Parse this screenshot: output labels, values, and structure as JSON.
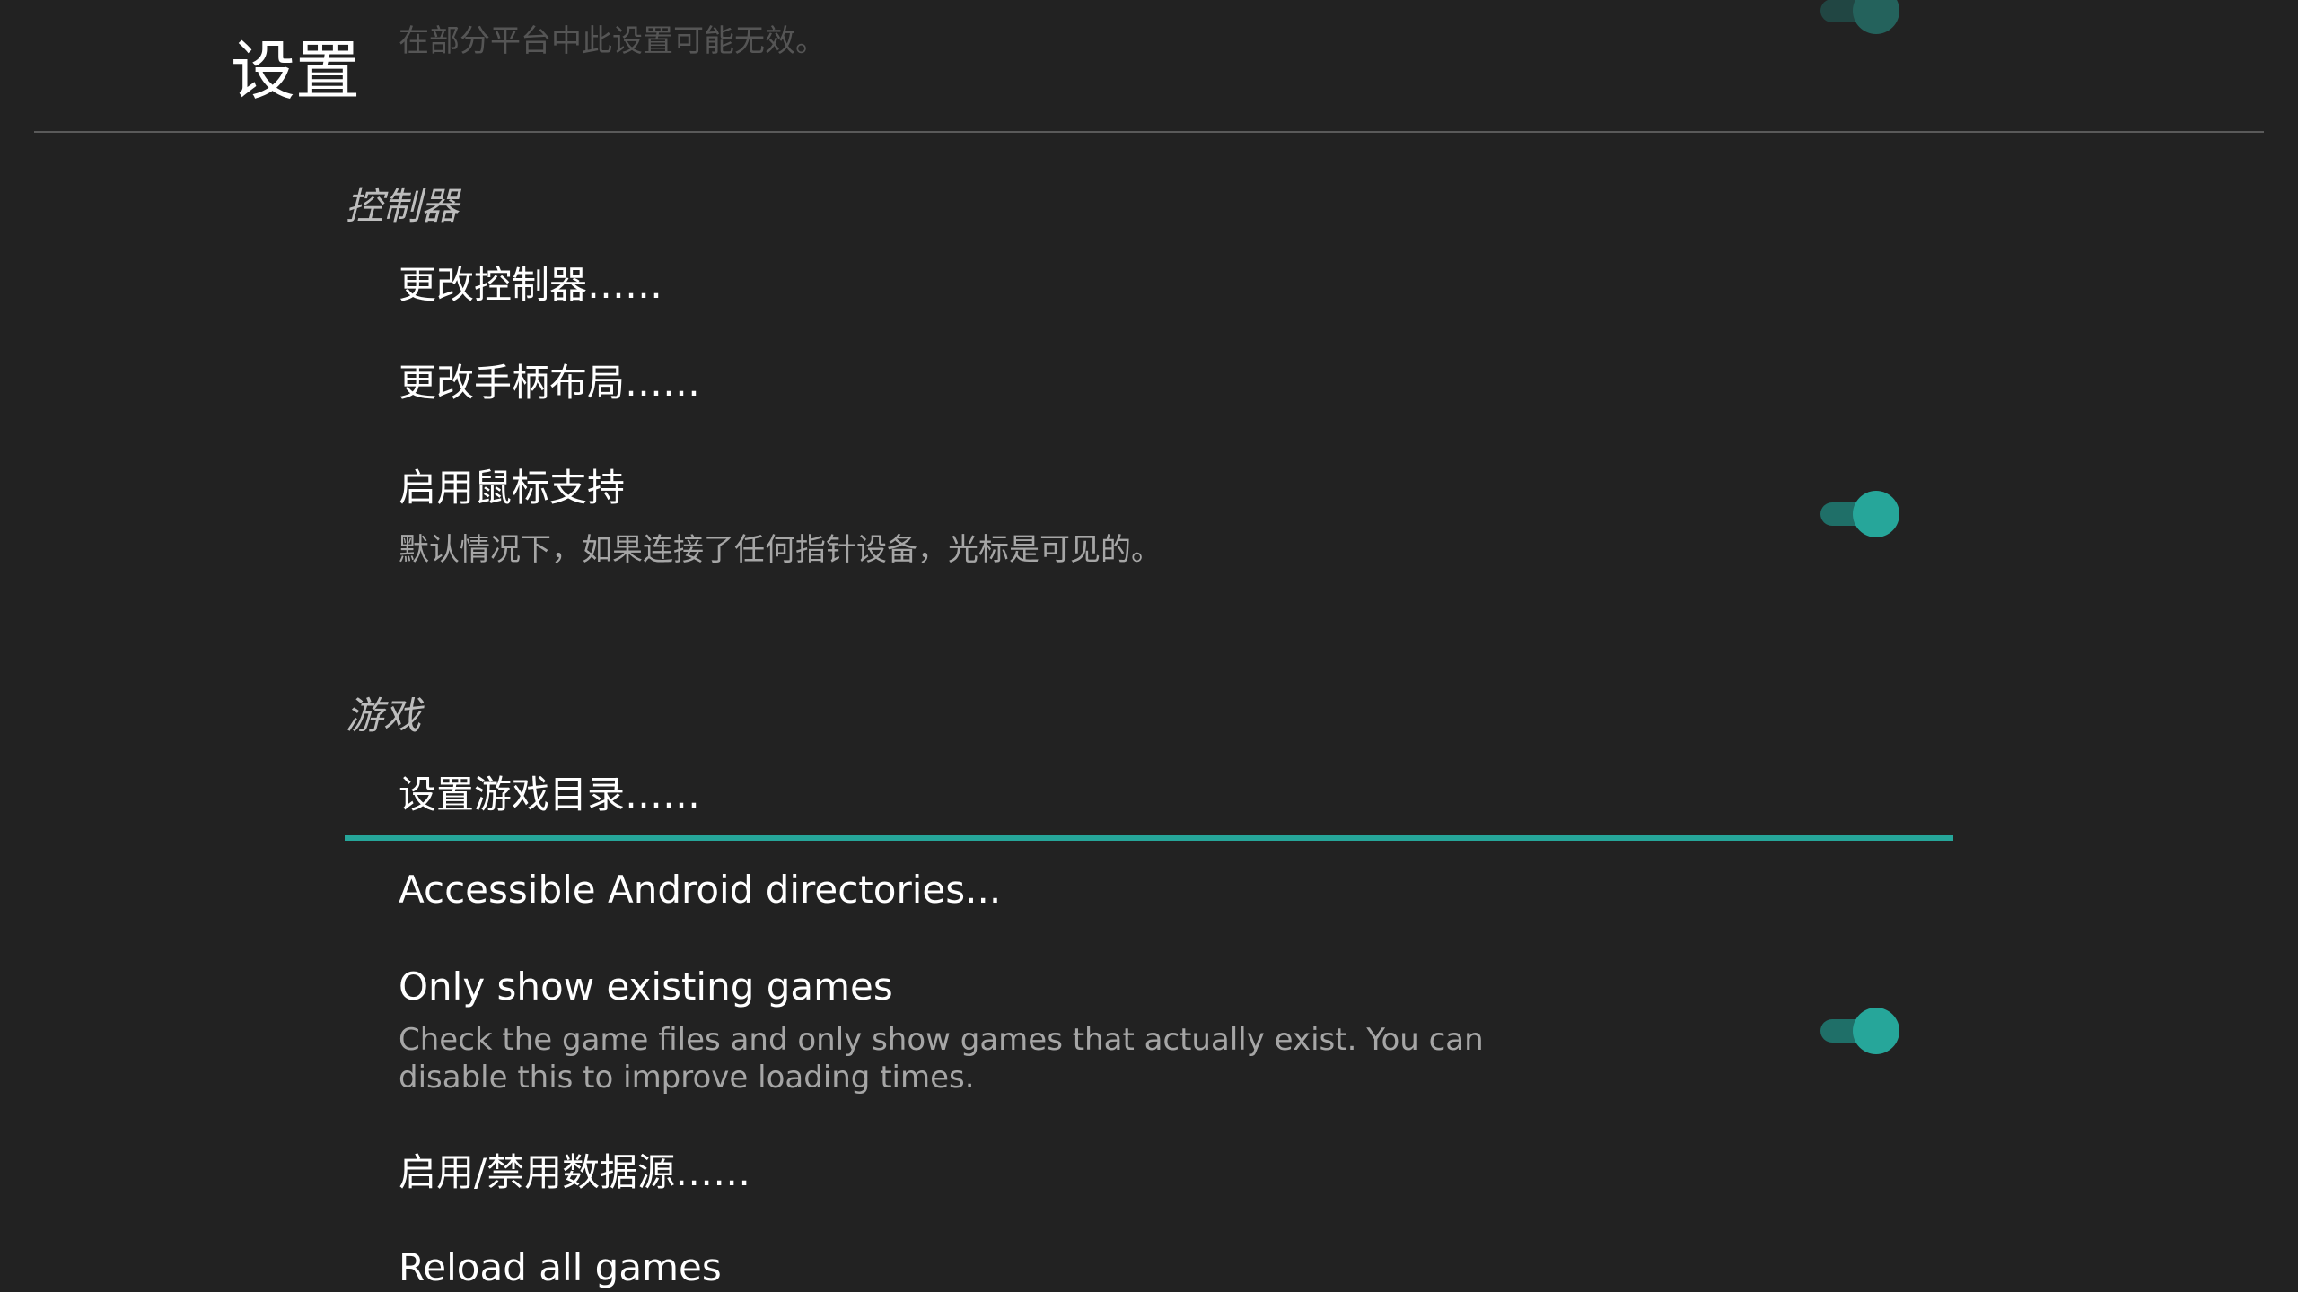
{
  "header": {
    "title": "设置"
  },
  "scrolled_item": {
    "summary": "在部分平台中此设置可能无效。",
    "toggle_on": true
  },
  "sections": {
    "controller": {
      "label": "控制器",
      "items": [
        {
          "title": "更改控制器……"
        },
        {
          "title": "更改手柄布局……"
        },
        {
          "title": "启用鼠标支持",
          "summary": "默认情况下，如果连接了任何指针设备，光标是可见的。",
          "toggle_on": true
        }
      ]
    },
    "games": {
      "label": "游戏",
      "items": [
        {
          "title": "设置游戏目录……",
          "focused": true
        },
        {
          "title": "Accessible Android directories..."
        },
        {
          "title": "Only show existing games",
          "summary": "Check the game files and only show games that actually exist. You can disable this to improve loading times.",
          "toggle_on": true
        },
        {
          "title": "启用/禁用数据源……"
        },
        {
          "title": "Reload all games"
        }
      ]
    }
  },
  "colors": {
    "background": "#222222",
    "accent": "#26a69a",
    "divider": "#5a5a5a",
    "primary_text": "#ffffff",
    "secondary_text": "#a6a6a6"
  }
}
